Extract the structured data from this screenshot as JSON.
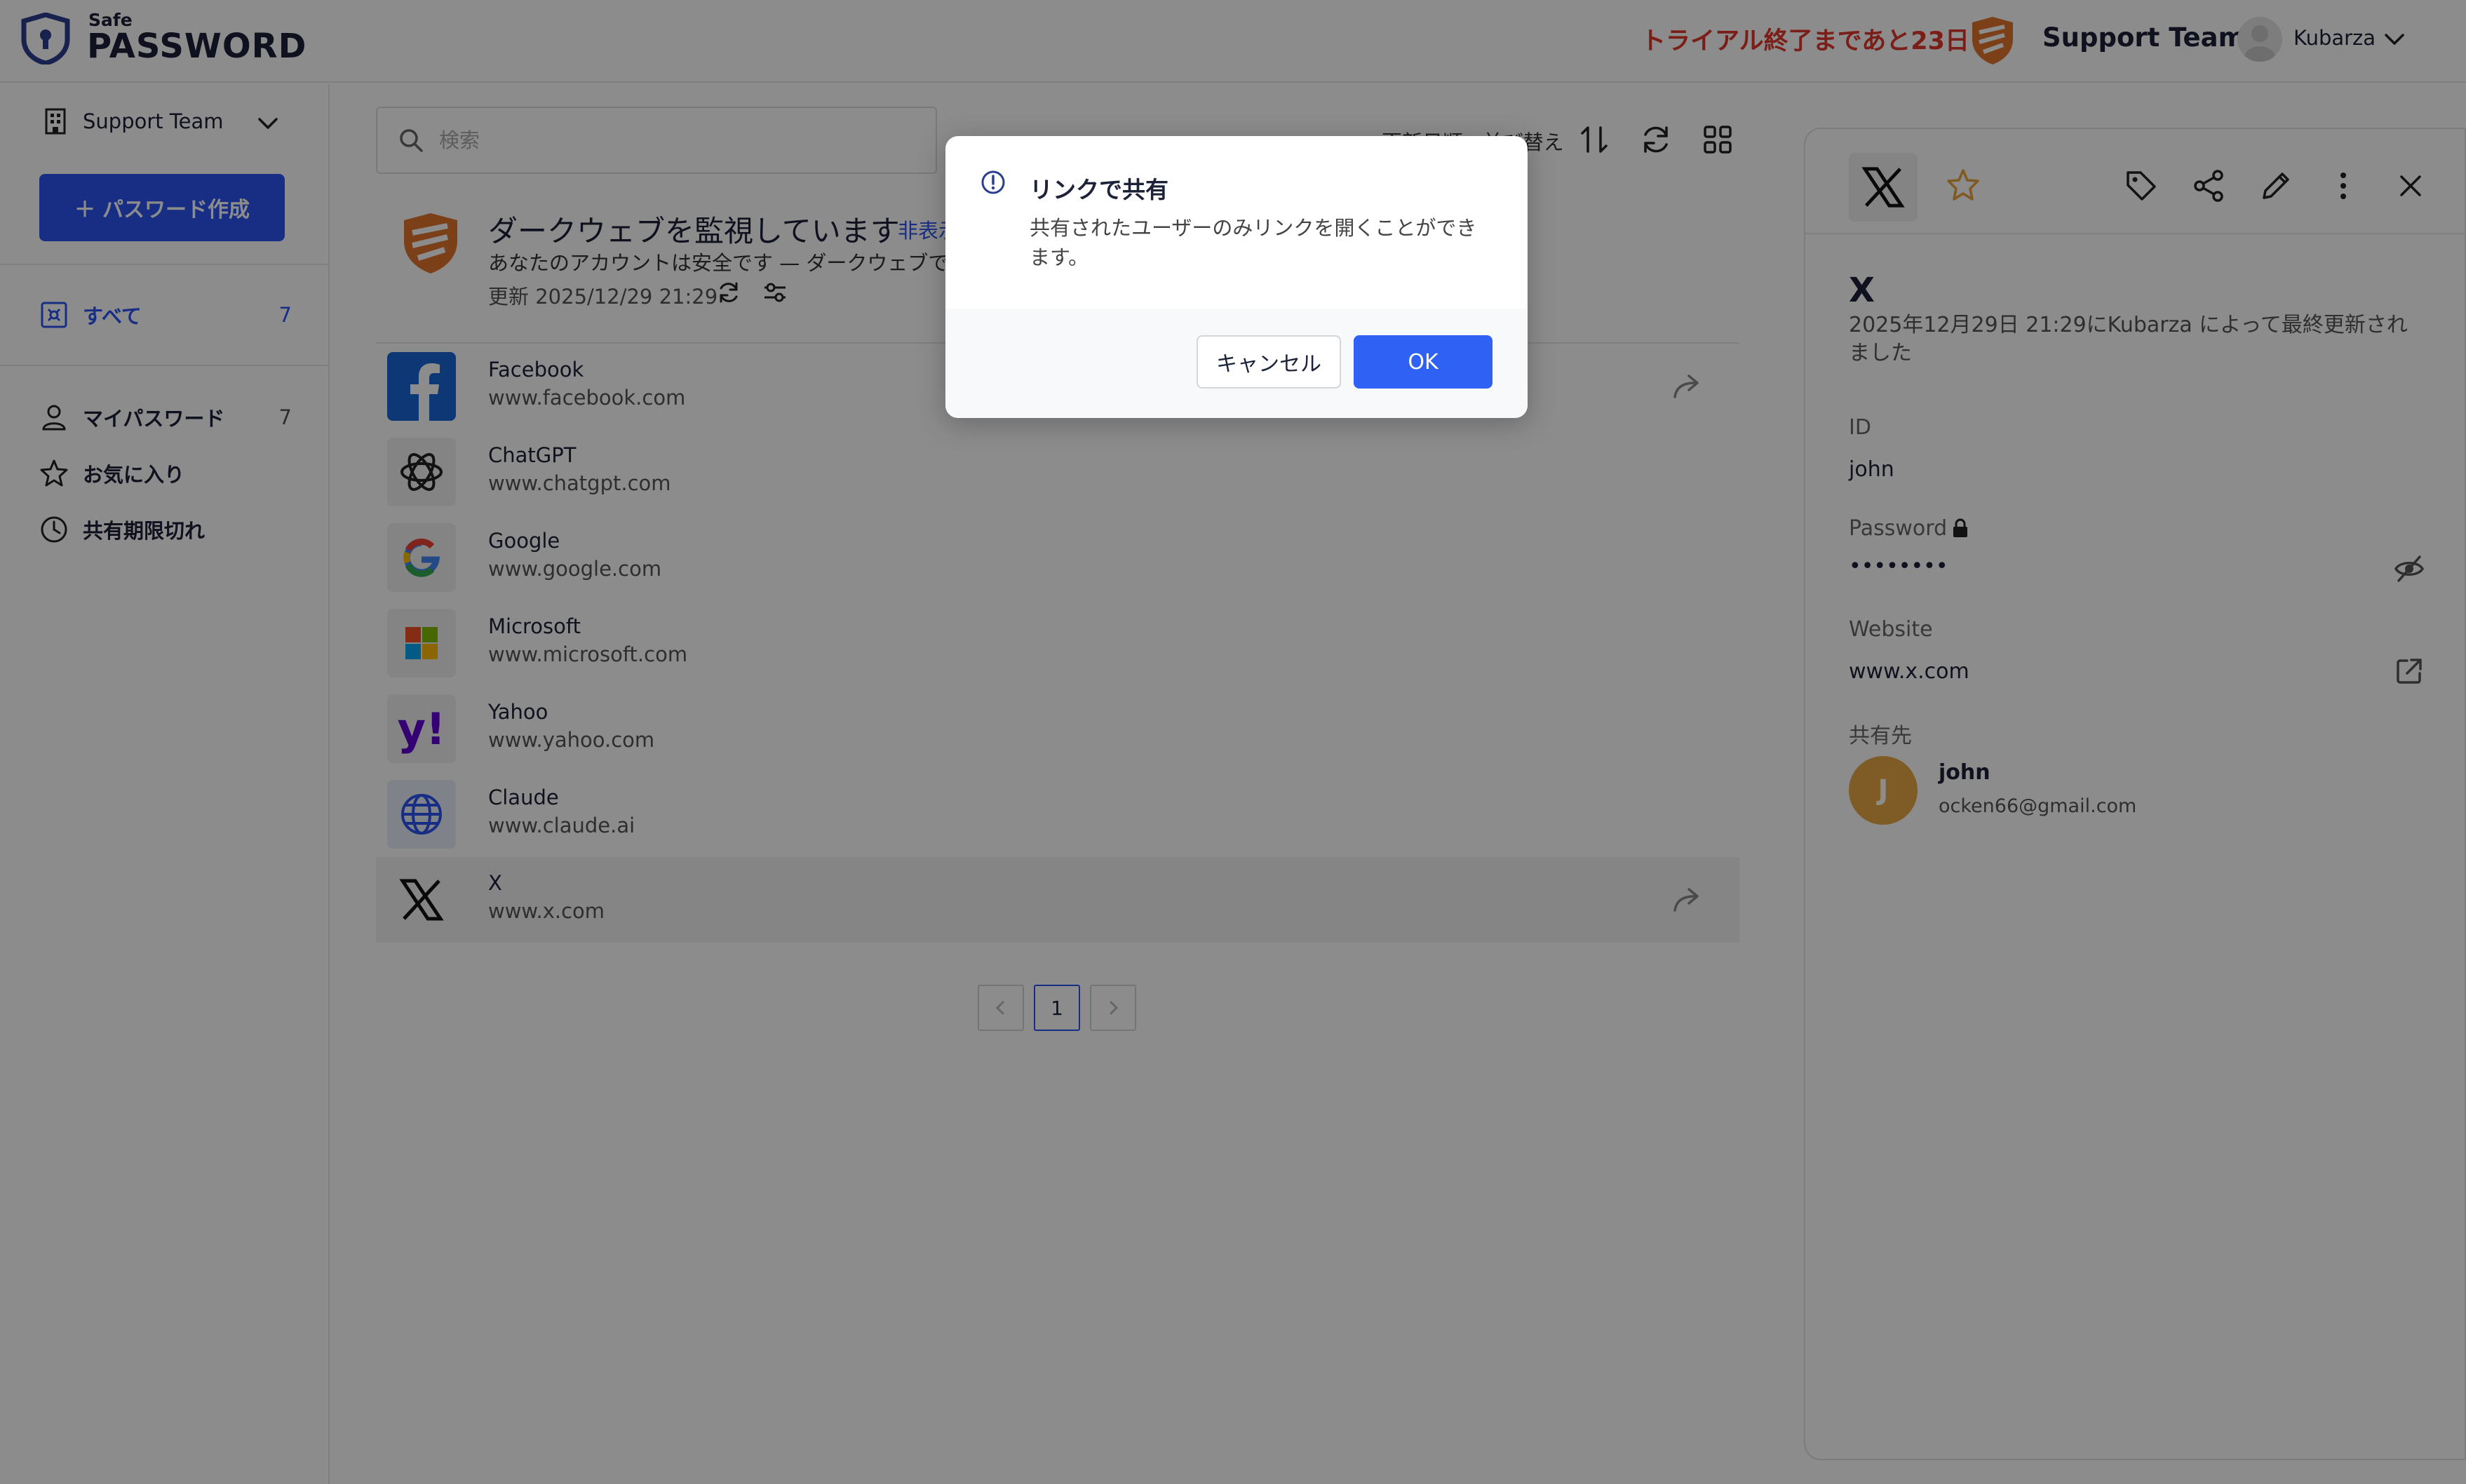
{
  "header": {
    "logo_small": "Safe",
    "logo_big": "PASSWORD",
    "trial_notice": "トライアル終了まであと23日",
    "team_name": "Support Team",
    "user_name": "Kubarza"
  },
  "sidebar": {
    "team_selector": "Support Team",
    "create_button": "パスワード作成",
    "nav": [
      {
        "label": "すべて",
        "count": "7",
        "active": true
      },
      {
        "label": "マイパスワード",
        "count": "7"
      },
      {
        "label": "お気に入り",
        "count": ""
      },
      {
        "label": "共有期限切れ",
        "count": ""
      }
    ]
  },
  "main": {
    "search_placeholder": "検索",
    "toolbar_sort_label": "更新日順 · 並び替え",
    "darkweb": {
      "title": "ダークウェブを監視しています",
      "hide_link": "非表示",
      "subtitle": "あなたのアカウントは安全です — ダークウェブで何",
      "updated": "更新 2025/12/29 21:29"
    },
    "items": [
      {
        "name": "Facebook",
        "url": "www.facebook.com"
      },
      {
        "name": "ChatGPT",
        "url": "www.chatgpt.com"
      },
      {
        "name": "Google",
        "url": "www.google.com"
      },
      {
        "name": "Microsoft",
        "url": "www.microsoft.com"
      },
      {
        "name": "Yahoo",
        "url": "www.yahoo.com"
      },
      {
        "name": "Claude",
        "url": "www.claude.ai"
      },
      {
        "name": "X",
        "url": "www.x.com"
      }
    ],
    "pagination": {
      "current": "1"
    }
  },
  "detail": {
    "title": "X",
    "updated_text": "2025年12月29日 21:29にKubarza によって最終更新されました",
    "id_label": "ID",
    "id_value": "john",
    "password_label": "Password",
    "password_value": "••••••••",
    "website_label": "Website",
    "website_value": "www.x.com",
    "shared_label": "共有先",
    "shared_user": {
      "initial": "J",
      "name": "john",
      "email": "ocken66@gmail.com"
    }
  },
  "dialog": {
    "title": "リンクで共有",
    "message": "共有されたユーザーのみリンクを開くことができます。",
    "cancel_label": "キャンセル",
    "ok_label": "OK"
  },
  "colors": {
    "accent": "#2c55f0",
    "trial": "#e0372c",
    "avatar": "#e8a745"
  }
}
